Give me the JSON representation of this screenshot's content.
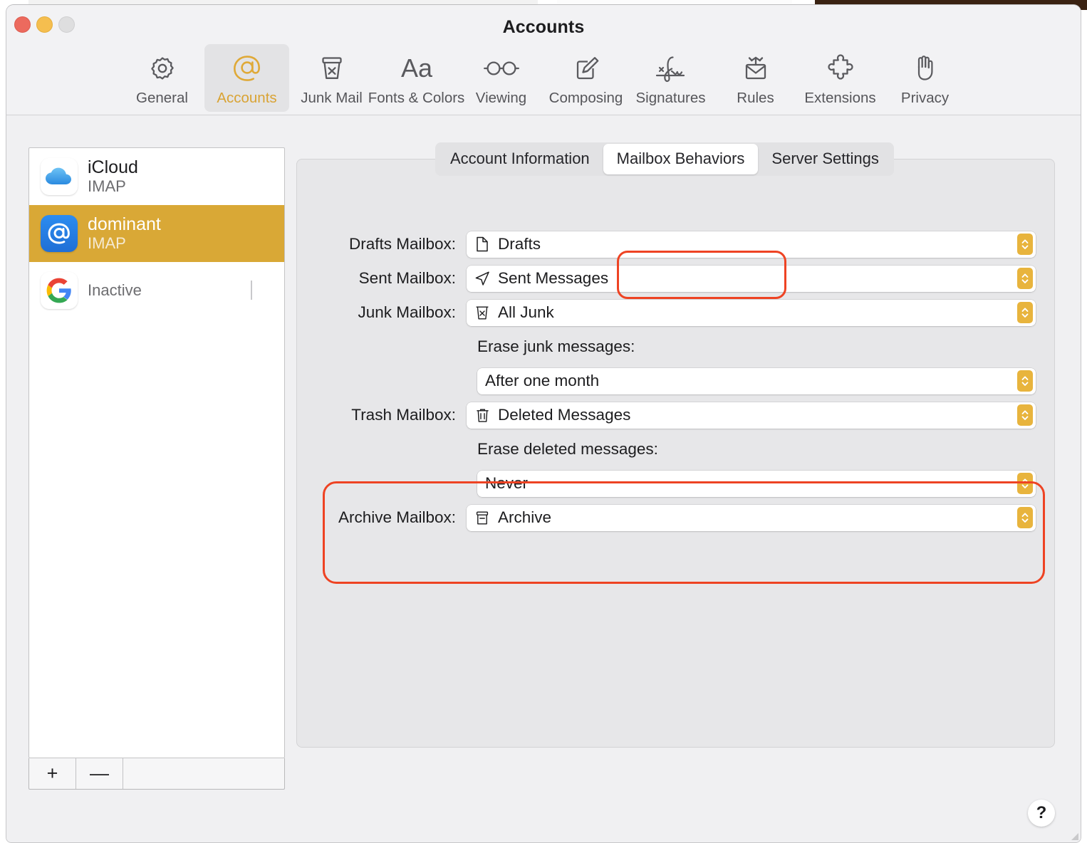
{
  "window": {
    "title": "Accounts",
    "traffic_lights": [
      "close",
      "minimize",
      "zoom"
    ]
  },
  "toolbar": {
    "items": [
      {
        "label": "General",
        "icon": "gear-icon",
        "selected": false
      },
      {
        "label": "Accounts",
        "icon": "at-sign-icon",
        "selected": true
      },
      {
        "label": "Junk Mail",
        "icon": "junk-trash-icon",
        "selected": false
      },
      {
        "label": "Fonts & Colors",
        "icon": "font-aa-icon",
        "selected": false
      },
      {
        "label": "Viewing",
        "icon": "glasses-icon",
        "selected": false
      },
      {
        "label": "Composing",
        "icon": "compose-pencil-icon",
        "selected": false
      },
      {
        "label": "Signatures",
        "icon": "signature-icon",
        "selected": false
      },
      {
        "label": "Rules",
        "icon": "rules-envelope-icon",
        "selected": false
      },
      {
        "label": "Extensions",
        "icon": "puzzle-piece-icon",
        "selected": false
      },
      {
        "label": "Privacy",
        "icon": "hand-icon",
        "selected": false
      }
    ],
    "accent_color": "#d9a334"
  },
  "sidebar": {
    "accounts": [
      {
        "name": "iCloud",
        "type": "IMAP",
        "icon": "icloud-icon",
        "selected": false
      },
      {
        "name": "dominant",
        "type": "IMAP",
        "icon": "at-mail-icon",
        "selected": true
      },
      {
        "name": "",
        "type": "Inactive",
        "icon": "google-icon",
        "selected": false
      }
    ],
    "selection_color": "#d9a836",
    "footer": {
      "add_label": "+",
      "remove_label": "—"
    }
  },
  "detail": {
    "tabs": [
      {
        "label": "Account Information",
        "active": false
      },
      {
        "label": "Mailbox Behaviors",
        "active": true
      },
      {
        "label": "Server Settings",
        "active": false
      }
    ],
    "rows": [
      {
        "label": "Drafts Mailbox:",
        "value": "Drafts",
        "icon": "document-icon",
        "indent": false
      },
      {
        "label": "Sent Mailbox:",
        "value": "Sent Messages",
        "icon": "paper-plane-icon",
        "indent": false
      },
      {
        "label": "Junk Mailbox:",
        "value": "All Junk",
        "icon": "junk-trash-icon",
        "indent": false
      }
    ],
    "erase_junk": {
      "caption": "Erase junk messages:",
      "value": "After one month"
    },
    "trash_row": {
      "label": "Trash Mailbox:",
      "value": "Deleted Messages",
      "icon": "trash-icon"
    },
    "erase_deleted": {
      "caption": "Erase deleted messages:",
      "value": "Never"
    },
    "archive_row": {
      "label": "Archive Mailbox:",
      "value": "Archive",
      "icon": "archive-box-icon"
    }
  },
  "annotations": {
    "color": "#ee4323",
    "targets": [
      "Mailbox Behaviors tab",
      "Trash Mailbox section"
    ]
  },
  "help": {
    "label": "?"
  }
}
